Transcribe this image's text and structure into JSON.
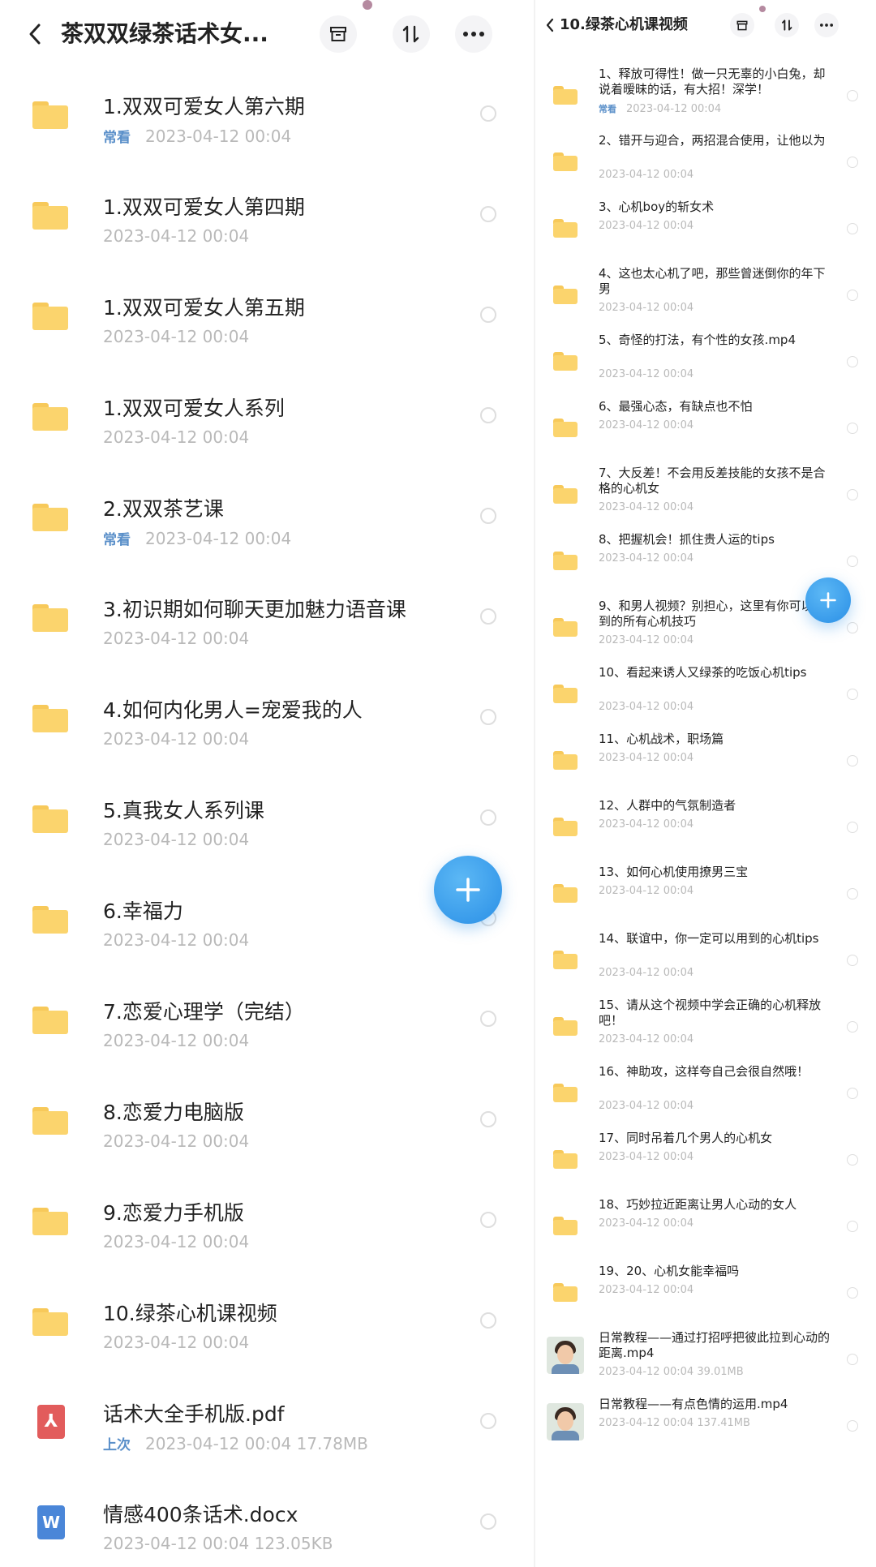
{
  "left": {
    "header": {
      "title": "茶双双绿茶话术女..."
    },
    "items": [
      {
        "type": "folder",
        "name": "1.双双可爱女人第六期",
        "badge": "常看",
        "date": "2023-04-12",
        "time": "00:04"
      },
      {
        "type": "folder",
        "name": "1.双双可爱女人第四期",
        "date": "2023-04-12",
        "time": "00:04"
      },
      {
        "type": "folder",
        "name": "1.双双可爱女人第五期",
        "date": "2023-04-12",
        "time": "00:04"
      },
      {
        "type": "folder",
        "name": "1.双双可爱女人系列",
        "date": "2023-04-12",
        "time": "00:04"
      },
      {
        "type": "folder",
        "name": "2.双双茶艺课",
        "badge": "常看",
        "date": "2023-04-12",
        "time": "00:04"
      },
      {
        "type": "folder",
        "name": "3.初识期如何聊天更加魅力语音课",
        "date": "2023-04-12",
        "time": "00:04"
      },
      {
        "type": "folder",
        "name": "4.如何内化男人=宠爱我的人",
        "date": "2023-04-12",
        "time": "00:04"
      },
      {
        "type": "folder",
        "name": "5.真我女人系列课",
        "date": "2023-04-12",
        "time": "00:04"
      },
      {
        "type": "folder",
        "name": "6.幸福力",
        "date": "2023-04-12",
        "time": "00:04"
      },
      {
        "type": "folder",
        "name": "7.恋爱心理学（完结）",
        "date": "2023-04-12",
        "time": "00:04"
      },
      {
        "type": "folder",
        "name": "8.恋爱力电脑版",
        "date": "2023-04-12",
        "time": "00:04"
      },
      {
        "type": "folder",
        "name": "9.恋爱力手机版",
        "date": "2023-04-12",
        "time": "00:04"
      },
      {
        "type": "folder",
        "name": "10.绿茶心机课视频",
        "date": "2023-04-12",
        "time": "00:04"
      },
      {
        "type": "pdf",
        "name": "话术大全手机版.pdf",
        "badge": "上次",
        "date": "2023-04-12",
        "time": "00:04",
        "size": "17.78MB"
      },
      {
        "type": "docx",
        "name": "情感400条话术.docx",
        "date": "2023-04-12",
        "time": "00:04",
        "size": "123.05KB"
      }
    ]
  },
  "right": {
    "header": {
      "title": "10.绿茶心机课视频"
    },
    "items": [
      {
        "type": "folder",
        "name": "1、释放可得性！做一只无辜的小白兔，却说着暧昧的话，有大招！深学！",
        "badge": "常看",
        "date": "2023-04-12",
        "time": "00:04"
      },
      {
        "type": "folder",
        "name": "2、错开与迎合，两招混合使用，让他以为",
        "date": "2023-04-12",
        "time": "00:04"
      },
      {
        "type": "folder",
        "name": "3、心机boy的斩女术",
        "date": "2023-04-12",
        "time": "00:04"
      },
      {
        "type": "folder",
        "name": "4、这也太心机了吧，那些曾迷倒你的年下男",
        "date": "2023-04-12",
        "time": "00:04"
      },
      {
        "type": "folder",
        "name": "5、奇怪的打法，有个性的女孩.mp4",
        "date": "2023-04-12",
        "time": "00:04"
      },
      {
        "type": "folder",
        "name": "6、最强心态，有缺点也不怕",
        "date": "2023-04-12",
        "time": "00:04"
      },
      {
        "type": "folder",
        "name": "7、大反差！不会用反差技能的女孩不是合格的心机女",
        "date": "2023-04-12",
        "time": "00:04"
      },
      {
        "type": "folder",
        "name": "8、把握机会！抓住贵人运的tips",
        "date": "2023-04-12",
        "time": "00:04"
      },
      {
        "type": "folder",
        "name": "9、和男人视频？别担心，这里有你可以用到的所有心机技巧",
        "date": "2023-04-12",
        "time": "00:04"
      },
      {
        "type": "folder",
        "name": "10、看起来诱人又绿茶的吃饭心机tips",
        "date": "2023-04-12",
        "time": "00:04"
      },
      {
        "type": "folder",
        "name": "11、心机战术，职场篇",
        "date": "2023-04-12",
        "time": "00:04"
      },
      {
        "type": "folder",
        "name": "12、人群中的气氛制造者",
        "date": "2023-04-12",
        "time": "00:04"
      },
      {
        "type": "folder",
        "name": "13、如何心机使用撩男三宝",
        "date": "2023-04-12",
        "time": "00:04"
      },
      {
        "type": "folder",
        "name": "14、联谊中，你一定可以用到的心机tips",
        "date": "2023-04-12",
        "time": "00:04"
      },
      {
        "type": "folder",
        "name": "15、请从这个视频中学会正确的心机释放吧！",
        "date": "2023-04-12",
        "time": "00:04"
      },
      {
        "type": "folder",
        "name": "16、神助攻，这样夸自己会很自然哦！",
        "date": "2023-04-12",
        "time": "00:04"
      },
      {
        "type": "folder",
        "name": "17、同时吊着几个男人的心机女",
        "date": "2023-04-12",
        "time": "00:04"
      },
      {
        "type": "folder",
        "name": "18、巧妙拉近距离让男人心动的女人",
        "date": "2023-04-12",
        "time": "00:04"
      },
      {
        "type": "folder",
        "name": "19、20、心机女能幸福吗",
        "date": "2023-04-12",
        "time": "00:04"
      },
      {
        "type": "video",
        "name": "日常教程——通过打招呼把彼此拉到心动的距离.mp4",
        "date": "2023-04-12",
        "time": "00:04",
        "size": "39.01MB"
      },
      {
        "type": "video",
        "name": "日常教程——有点色情的运用.mp4",
        "date": "2023-04-12",
        "time": "00:04",
        "size": "137.41MB"
      }
    ]
  },
  "icons": {
    "back": "chevron-left-icon",
    "archive": "archive-icon",
    "sort": "sort-icon",
    "more": "more-icon",
    "add": "plus-icon"
  },
  "colors": {
    "folder": "#fbd46d",
    "fab": "#2a8fe6",
    "badge": "#5a8fc9",
    "meta": "#b9b9b9"
  }
}
